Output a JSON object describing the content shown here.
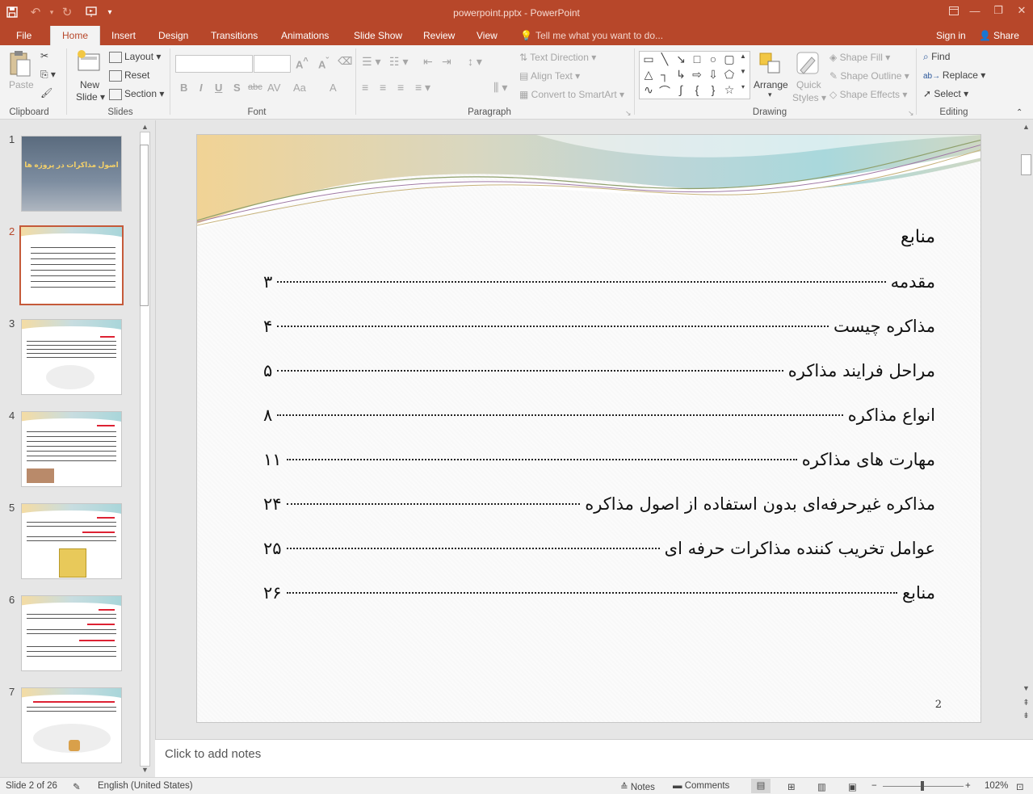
{
  "window": {
    "title": "powerpoint.pptx - PowerPoint",
    "controls": [
      "restore-ribbon",
      "minimize",
      "maximize",
      "close"
    ]
  },
  "colors": {
    "accent": "#b7472a",
    "ribbon_bg": "#f3f3f3",
    "selected_thumb_border": "#c55a3a"
  },
  "tabs": [
    "File",
    "Home",
    "Insert",
    "Design",
    "Transitions",
    "Animations",
    "Slide Show",
    "Review",
    "View"
  ],
  "active_tab": "Home",
  "tell_me": "Tell me what you want to do...",
  "account": {
    "sign_in": "Sign in",
    "share": "Share"
  },
  "ribbon": {
    "clipboard": {
      "paste": "Paste",
      "label": "Clipboard"
    },
    "slides": {
      "new_slide_1": "New",
      "new_slide_2": "Slide",
      "layout": "Layout",
      "reset": "Reset",
      "section": "Section",
      "label": "Slides"
    },
    "font": {
      "label": "Font",
      "bold": "B",
      "italic": "I",
      "underline": "U",
      "shadow": "S",
      "strike": "abc",
      "spacing": "AV",
      "case": "Aa",
      "color": "A"
    },
    "paragraph": {
      "label": "Paragraph",
      "text_direction": "Text Direction",
      "align_text": "Align Text",
      "smartart": "Convert to SmartArt"
    },
    "drawing": {
      "label": "Drawing",
      "arrange": "Arrange",
      "quick_1": "Quick",
      "quick_2": "Styles",
      "shape_fill": "Shape Fill",
      "shape_outline": "Shape Outline",
      "shape_effects": "Shape Effects"
    },
    "editing": {
      "label": "Editing",
      "find": "Find",
      "replace": "Replace",
      "select": "Select"
    }
  },
  "thumbnails": [
    {
      "num": "1",
      "title": "اصول مذاکرات در پروژه ها"
    },
    {
      "num": "2"
    },
    {
      "num": "3"
    },
    {
      "num": "4"
    },
    {
      "num": "5"
    },
    {
      "num": "6"
    },
    {
      "num": "7"
    }
  ],
  "slide": {
    "heading": "منابع",
    "toc": [
      {
        "text": "مقدمه",
        "page": "۳"
      },
      {
        "text": "مذاکره چیست",
        "page": "۴"
      },
      {
        "text": "مراحل فرایند مذاکره",
        "page": "۵"
      },
      {
        "text": "انواع مذاکره",
        "page": "۸"
      },
      {
        "text": "مهارت های مذاکره",
        "page": "۱۱"
      },
      {
        "text": "مذاکره غیرحرفه‌ای بدون استفاده از اصول مذاکره",
        "page": "۲۴"
      },
      {
        "text": "عوامل تخریب کننده مذاکرات حرفه ای",
        "page": "۲۵"
      },
      {
        "text": "منابع",
        "page": "۲۶"
      }
    ],
    "number": "2"
  },
  "notes_placeholder": "Click to add notes",
  "status": {
    "slide_of": "Slide 2 of 26",
    "language": "English (United States)",
    "notes": "Notes",
    "comments": "Comments",
    "zoom": "102%"
  }
}
